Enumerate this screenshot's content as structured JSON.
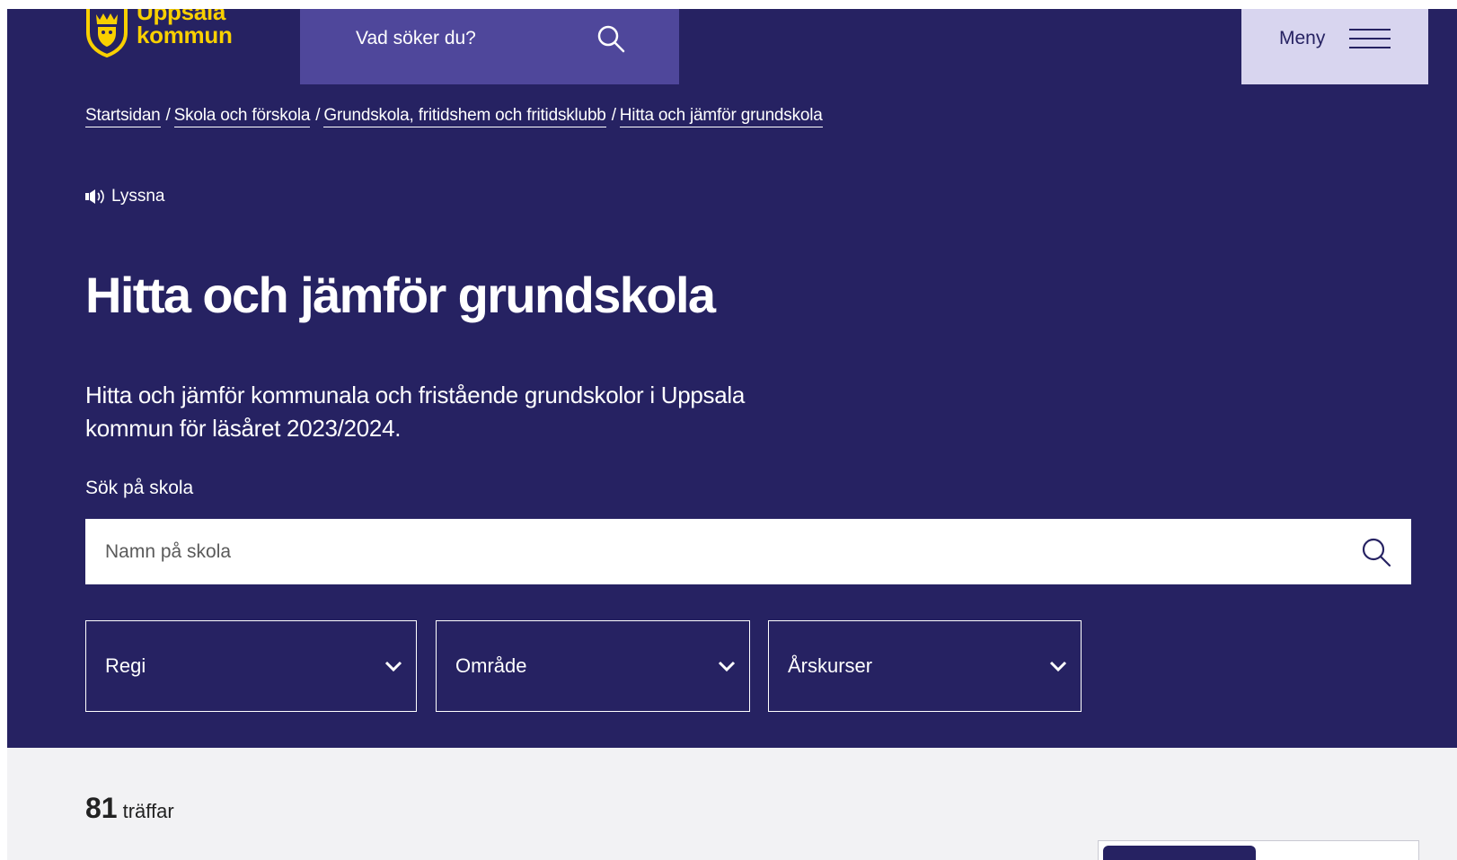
{
  "brand": {
    "name_line1": "Uppsala",
    "name_line2": "kommun",
    "color": "#f9d000"
  },
  "header": {
    "search_label": "Vad söker du?",
    "menu_label": "Meny"
  },
  "breadcrumb": [
    {
      "label": "Startsidan"
    },
    {
      "label": "Skola och förskola"
    },
    {
      "label": "Grundskola, fritidshem och fritidsklubb"
    },
    {
      "label": "Hitta och jämför grundskola"
    }
  ],
  "breadcrumb_separator": "/",
  "listen": {
    "label": "Lyssna",
    "icon": "speaker-icon"
  },
  "page": {
    "title": "Hitta och jämför grundskola",
    "intro": "Hitta och jämför kommunala och fristående grundskolor i Uppsala kommun för läsåret 2023/2024."
  },
  "search": {
    "label": "Sök på skola",
    "placeholder": "Namn på skola",
    "value": ""
  },
  "filters": [
    {
      "label": "Regi"
    },
    {
      "label": "Område"
    },
    {
      "label": "Årskurser"
    }
  ],
  "results": {
    "count": "81",
    "label": "träffar"
  },
  "colors": {
    "hero_bg": "#262262",
    "top_search_bg": "#4f479b",
    "menu_bg": "#d8d5ef",
    "page_bg": "#f2f2f4"
  }
}
